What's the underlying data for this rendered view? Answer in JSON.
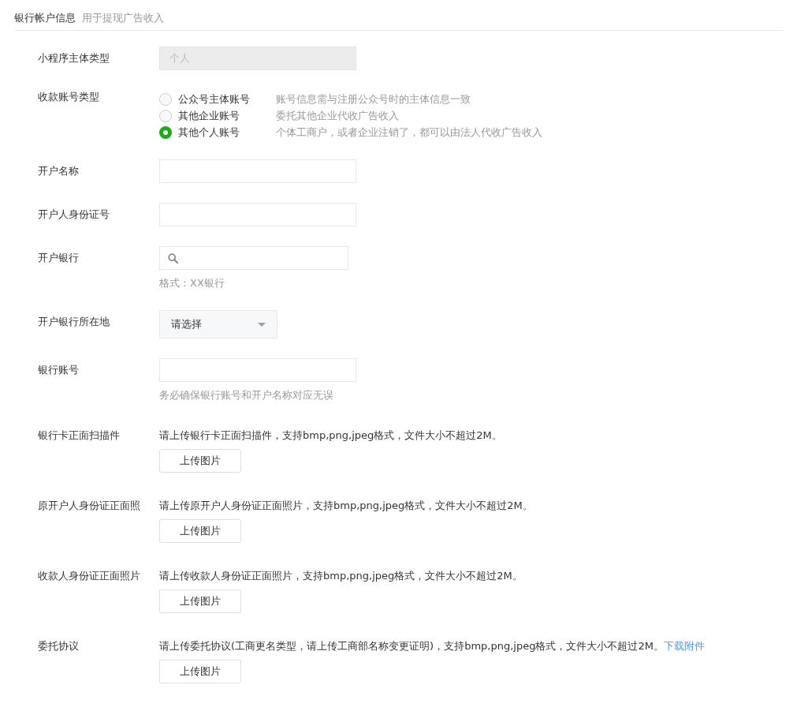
{
  "header": {
    "title": "银行帐户信息",
    "subtitle": "用于提现广告收入"
  },
  "rows": [
    {
      "kind": "readonly",
      "label": "小程序主体类型",
      "value": "个人"
    },
    {
      "kind": "radio",
      "label": "收款账号类型",
      "options": [
        {
          "label": "公众号主体账号",
          "hint": "账号信息需与注册公众号时的主体信息一致",
          "selected": false
        },
        {
          "label": "其他企业账号",
          "hint": "委托其他企业代收广告收入",
          "selected": false
        },
        {
          "label": "其他个人账号",
          "hint": "个体工商户，或者企业注销了，都可以由法人代收广告收入",
          "selected": true
        }
      ]
    },
    {
      "kind": "input",
      "label": "开户名称"
    },
    {
      "kind": "input",
      "label": "开户人身份证号"
    },
    {
      "kind": "search",
      "label": "开户银行",
      "hint": "格式：XX银行"
    },
    {
      "kind": "select",
      "label": "开户银行所在地",
      "value": "请选择"
    },
    {
      "kind": "input",
      "label": "银行账号",
      "hint": "务必确保银行账号和开户名称对应无误"
    },
    {
      "kind": "upload",
      "label": "银行卡正面扫描件",
      "text": "请上传银行卡正面扫描件，支持bmp,png,jpeg格式，文件大小不超过2M。",
      "button": "上传图片"
    },
    {
      "kind": "upload",
      "label": "原开户人身份证正面照",
      "text": "请上传原开户人身份证正面照片，支持bmp,png,jpeg格式，文件大小不超过2M。",
      "button": "上传图片"
    },
    {
      "kind": "upload",
      "label": "收款人身份证正面照片",
      "text": "请上传收款人身份证正面照片，支持bmp,png,jpeg格式，文件大小不超过2M。",
      "button": "上传图片"
    },
    {
      "kind": "upload",
      "label": "委托协议",
      "text": "请上传委托协议(工商更名类型，请上传工商部名称变更证明)，支持bmp,png,jpeg格式，文件大小不超过2M。",
      "link": "下载附件",
      "button": "上传图片"
    }
  ]
}
